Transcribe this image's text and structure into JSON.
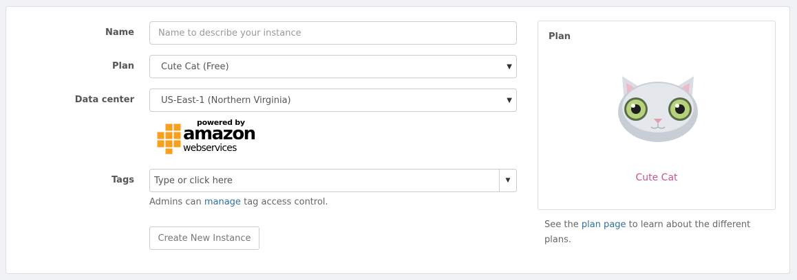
{
  "form": {
    "name_label": "Name",
    "name_placeholder": "Name to describe your instance",
    "name_value": "",
    "plan_label": "Plan",
    "plan_value": "Cute Cat (Free)",
    "datacenter_label": "Data center",
    "datacenter_value": "US-East-1 (Northern Virginia)",
    "aws_logo": {
      "powered_by": "powered by",
      "amazon": "amazon",
      "web_services": "webservices"
    },
    "tags_label": "Tags",
    "tags_placeholder": "Type or click here",
    "tags_help_prefix": "Admins can",
    "tags_help_link": "manage",
    "tags_help_suffix": "tag access control.",
    "create_button": "Create New Instance"
  },
  "plan_panel": {
    "title": "Plan",
    "plan_name": "Cute Cat",
    "note_prefix": "See the",
    "note_link": "plan page",
    "note_suffix": "to learn about the different plans."
  },
  "colors": {
    "link": "#31709a",
    "plan_name": "#c9558f",
    "aws_orange": "#f7a01d"
  },
  "icons": {
    "select_caret": "caret-down-icon",
    "tags_toggle": "caret-down-icon"
  }
}
